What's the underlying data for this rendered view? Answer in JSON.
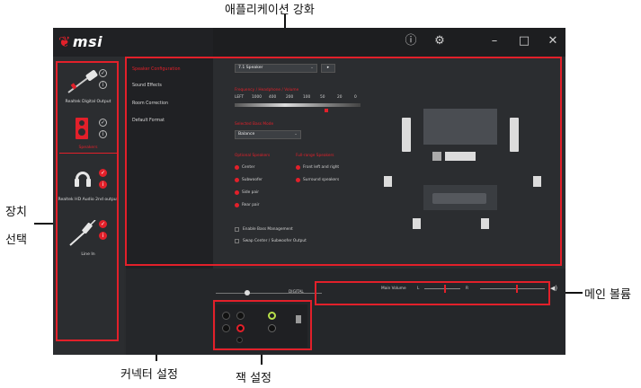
{
  "callouts": {
    "app_enhancement": "애플리케이션 강화",
    "device_select_1": "장치",
    "device_select_2": "선택",
    "main_volume": "메인 볼륨",
    "connector_settings": "커넥터 설정",
    "jack_settings": "잭 설정"
  },
  "app": {
    "brand": "msi",
    "title_controls": {
      "info": "ⓘ",
      "settings": "⚙",
      "minimize": "–",
      "maximize": "□",
      "close": "✕"
    }
  },
  "devices": [
    {
      "label": "Realtek Digital Output"
    },
    {
      "label": "Speakers"
    },
    {
      "label": "Realtek HD Audio 2nd output"
    },
    {
      "label": "Line In"
    }
  ],
  "menu": [
    {
      "label": "Speaker Configuration",
      "active": true
    },
    {
      "label": "Sound Effects",
      "active": false
    },
    {
      "label": "Room Correction",
      "active": false
    },
    {
      "label": "Default Format",
      "active": false
    }
  ],
  "config": {
    "speaker_select": "7.1 Speaker",
    "freq_heading": "Frequency / Headphone / Volume",
    "freq_ticks": [
      "LEFT",
      "1000",
      "400",
      "200",
      "100",
      "50",
      "20",
      "0"
    ],
    "balance_heading": "Selected Bass Mode",
    "balance_select": "Balance",
    "full_range_heading": "Optional Speakers",
    "full_range_items": [
      "Center",
      "Subwoofer",
      "Side pair",
      "Rear pair"
    ],
    "full_range2_heading": "Full-range Speakers",
    "full_range2_items": [
      "Front left and right",
      "Surround speakers"
    ],
    "checkbox_items": [
      "Enable Bass Management",
      "Swap Center / Subwoofer Output"
    ]
  },
  "bottom": {
    "digital_label": "DIGITAL",
    "main_volume_label": "Main Volume",
    "volume_l": "L",
    "volume_r": "R",
    "slider_left": 0.55,
    "slider_right": 0.55
  }
}
